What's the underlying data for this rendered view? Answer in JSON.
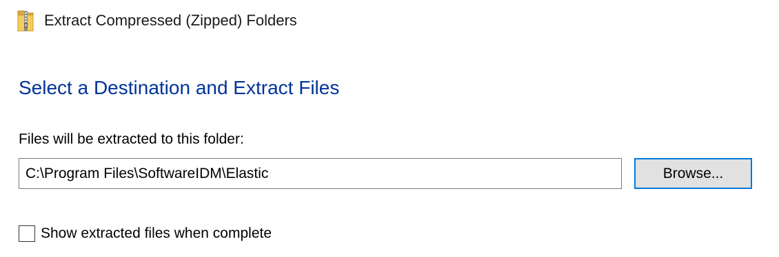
{
  "window": {
    "title": "Extract Compressed (Zipped) Folders",
    "icon": "zip-folder-icon"
  },
  "main": {
    "heading": "Select a Destination and Extract Files",
    "destination_label": "Files will be extracted to this folder:",
    "destination_path": "C:\\Program Files\\SoftwareIDM\\Elastic",
    "browse_label": "Browse...",
    "show_files_label": "Show extracted files when complete",
    "show_files_checked": false
  },
  "colors": {
    "heading": "#003399",
    "focus_border": "#0078d7",
    "button_bg": "#e1e1e1"
  }
}
